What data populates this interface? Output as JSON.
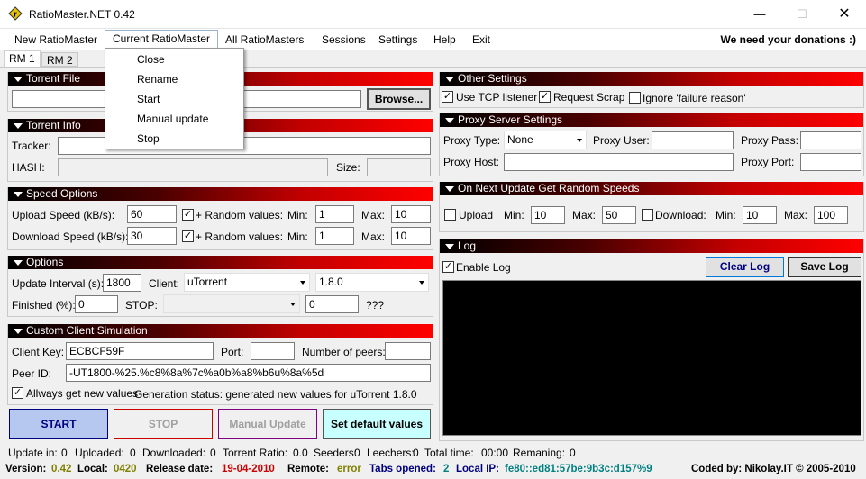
{
  "window": {
    "title": "RatioMaster.NET 0.42"
  },
  "menu": {
    "items": [
      "New RatioMaster",
      "Current RatioMaster",
      "All RatioMasters",
      "Sessions",
      "Settings",
      "Help",
      "Exit"
    ],
    "donation": "We need your donations :)",
    "dropdown": [
      "Close",
      "Rename",
      "Start",
      "Manual update",
      "Stop"
    ]
  },
  "tabs": [
    "RM 1",
    "RM 2"
  ],
  "torrent_file": {
    "header": "Torrent File",
    "path": "",
    "browse_label": "Browse..."
  },
  "torrent_info": {
    "header": "Torrent Info",
    "tracker_label": "Tracker:",
    "tracker": "",
    "hash_label": "HASH:",
    "hash": "",
    "size_label": "Size:",
    "size": ""
  },
  "speed": {
    "header": "Speed Options",
    "upload_label": "Upload Speed (kB/s):",
    "upload": "60",
    "download_label": "Download Speed (kB/s):",
    "download": "30",
    "random_label": "+ Random values:",
    "min_label": "Min:",
    "max_label": "Max:",
    "up_min": "1",
    "up_max": "10",
    "down_min": "1",
    "down_max": "10"
  },
  "options": {
    "header": "Options",
    "interval_label": "Update Interval (s):",
    "interval": "1800",
    "client_label": "Client:",
    "client": "uTorrent",
    "client_version": "1.8.0",
    "finished_label": "Finished (%):",
    "finished": "0",
    "stop_label": "STOP:",
    "stop_value": "",
    "stop_amount": "0",
    "qqq": "???"
  },
  "custom_client": {
    "header": "Custom Client Simulation",
    "key_label": "Client Key:",
    "key": "ECBCF59F",
    "port_label": "Port:",
    "port": "",
    "peers_label": "Number of peers:",
    "peers": "",
    "peer_id_label": "Peer ID:",
    "peer_id": "-UT1800-%25.%c8%8a%7c%a0b%a8%b6u%8a%5d",
    "always_label": "Allways get new values",
    "gen_status": "Generation status: generated new values for uTorrent 1.8.0"
  },
  "buttons": {
    "start": "START",
    "stop": "STOP",
    "manual": "Manual Update",
    "default": "Set default values"
  },
  "other_settings": {
    "header": "Other Settings",
    "tcp": "Use TCP listener",
    "scrap": "Request Scrap",
    "ignore": "Ignore 'failure reason'"
  },
  "proxy": {
    "header": "Proxy Server Settings",
    "type_label": "Proxy Type:",
    "type": "None",
    "user_label": "Proxy User:",
    "user": "",
    "pass_label": "Proxy Pass:",
    "pass": "",
    "host_label": "Proxy Host:",
    "host": "",
    "port_label": "Proxy Port:",
    "port": ""
  },
  "random_speeds": {
    "header": "On Next Update Get Random Speeds",
    "upload_label": "Upload",
    "download_label": "Download:",
    "min_label": "Min:",
    "max_label": "Max:",
    "up_min": "10",
    "up_max": "50",
    "down_min": "10",
    "down_max": "100"
  },
  "log": {
    "header": "Log",
    "enable_label": "Enable Log",
    "clear_label": "Clear Log",
    "save_label": "Save Log"
  },
  "status": {
    "update_in_label": "Update in:",
    "update_in": "0",
    "uploaded_label": "Uploaded:",
    "uploaded": "0",
    "downloaded_label": "Downloaded:",
    "downloaded": "0",
    "ratio_label": "Torrent Ratio:",
    "ratio": "0.0",
    "seeders_label": "Seeders:",
    "seeders": "0",
    "leechers_label": "Leechers:",
    "leechers": "0",
    "total_label": "Total time:",
    "total": "00:00",
    "remaining_label": "Remaning:",
    "remaining": "0"
  },
  "info": {
    "version_label": "Version:",
    "version": "0.42",
    "local_label": "Local:",
    "local": "0420",
    "release_label": "Release date:",
    "release": "19-04-2010",
    "remote_label": "Remote:",
    "remote": "error",
    "tabs_label": "Tabs opened:",
    "tabs": "2",
    "ip_label": "Local IP:",
    "ip": "fe80::ed81:57be:9b3c:d157%9",
    "coded_by": "Coded by: Nikolay.IT © 2005-2010"
  },
  "colors": {
    "olive": "#808000",
    "red": "#cc0000",
    "blue": "#000080",
    "teal": "#008080"
  }
}
